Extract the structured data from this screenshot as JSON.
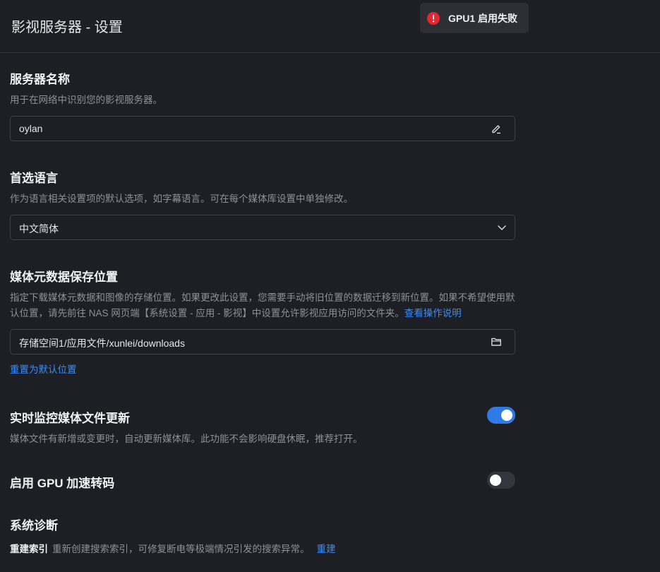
{
  "header": {
    "title": "影视服务器 - 设置"
  },
  "toast": {
    "message": "GPU1 启用失败",
    "icon": "error-icon",
    "color": "#e8262f"
  },
  "server_name": {
    "title": "服务器名称",
    "description": "用于在网络中识别您的影视服务器。",
    "value": "oylan",
    "icon": "edit-icon"
  },
  "language": {
    "title": "首选语言",
    "description": "作为语言相关设置项的默认选项，如字幕语言。可在每个媒体库设置中单独修改。",
    "selected": "中文简体",
    "icon": "chevron-down-icon"
  },
  "metadata_location": {
    "title": "媒体元数据保存位置",
    "description": "指定下载媒体元数据和图像的存储位置。如果更改此设置，您需要手动将旧位置的数据迁移到新位置。如果不希望使用默认位置，请先前往 NAS 网页端【系统设置 - 应用 - 影视】中设置允许影视应用访问的文件夹。",
    "help_link": "查看操作说明",
    "path": "存储空间1/应用文件/xunlei/downloads",
    "icon": "folder-icon",
    "reset_link": "重置为默认位置"
  },
  "realtime_monitor": {
    "title": "实时监控媒体文件更新",
    "description": "媒体文件有新增或变更时，自动更新媒体库。此功能不会影响硬盘休眠，推荐打开。",
    "enabled": true
  },
  "gpu_transcode": {
    "title": "启用 GPU 加速转码",
    "enabled": false
  },
  "diagnostics": {
    "title": "系统诊断",
    "rebuild_label": "重建索引",
    "rebuild_desc": "重新创建搜索索引，可修复断电等极端情况引发的搜索异常。",
    "rebuild_action": "重建"
  },
  "colors": {
    "accent": "#3b8cf5",
    "toggle_on": "#2f7be6",
    "background": "#1d1f25"
  }
}
